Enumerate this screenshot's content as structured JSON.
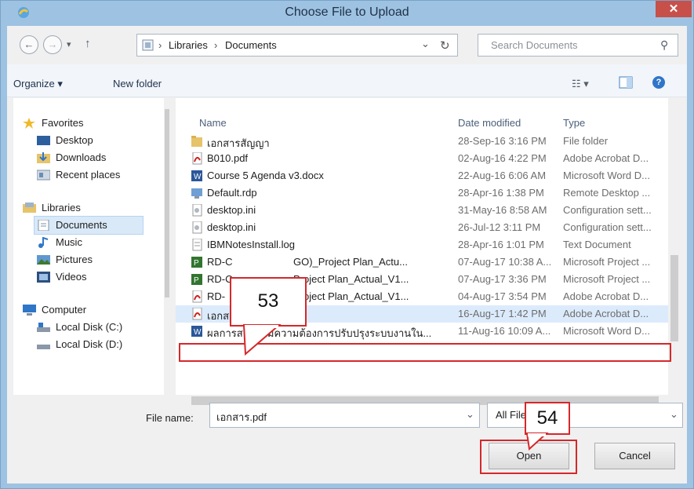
{
  "window": {
    "title": "Choose File to Upload",
    "close_glyph": "✕"
  },
  "nav_buttons": {
    "back": "←",
    "forward": "→",
    "recent": "▾",
    "up": "↑"
  },
  "address": {
    "crumbs": [
      "Libraries",
      "Documents"
    ],
    "sep": "›",
    "dropdown": "⌄",
    "refresh": "↻"
  },
  "search": {
    "placeholder": "Search Documents",
    "icon": "⚲"
  },
  "toolbar": {
    "organize": "Organize ▾",
    "new_folder": "New folder",
    "view": "☷ ▾",
    "help": "?"
  },
  "nav_pane": {
    "favorites": {
      "label": "Favorites",
      "items": [
        "Desktop",
        "Downloads",
        "Recent places"
      ]
    },
    "libraries": {
      "label": "Libraries",
      "items": [
        "Documents",
        "Music",
        "Pictures",
        "Videos"
      ]
    },
    "computer": {
      "label": "Computer",
      "items": [
        "Local Disk (C:)",
        "Local Disk (D:)"
      ]
    }
  },
  "columns": {
    "name": "Name",
    "date": "Date modified",
    "type": "Type"
  },
  "files": [
    {
      "name": "เอกสารสัญญา",
      "date": "28-Sep-16 3:16 PM",
      "type": "File folder",
      "icon": "folder-icon"
    },
    {
      "name": "B010.pdf",
      "date": "02-Aug-16 4:22 PM",
      "type": "Adobe Acrobat D...",
      "icon": "pdf-icon"
    },
    {
      "name": "Course 5 Agenda v3.docx",
      "date": "22-Aug-16 6:06 AM",
      "type": "Microsoft Word D...",
      "icon": "word-icon"
    },
    {
      "name": "Default.rdp",
      "date": "28-Apr-16 1:38 PM",
      "type": "Remote Desktop ...",
      "icon": "rdp-icon"
    },
    {
      "name": "desktop.ini",
      "date": "31-May-16 8:58 AM",
      "type": "Configuration sett...",
      "icon": "ini-icon"
    },
    {
      "name": "desktop.ini",
      "date": "26-Jul-12 3:11 PM",
      "type": "Configuration sett...",
      "icon": "ini-icon"
    },
    {
      "name": "IBMNotesInstall.log",
      "date": "28-Apr-16 1:01 PM",
      "type": "Text Document",
      "icon": "text-icon"
    },
    {
      "name": "RD-C",
      "name2": "GO)_Project Plan_Actu...",
      "date": "07-Aug-17 10:38 A...",
      "type": "Microsoft Project ...",
      "icon": "project-icon"
    },
    {
      "name": "RD-C",
      "name2": "Project Plan_Actual_V1...",
      "date": "07-Aug-17 3:36 PM",
      "type": "Microsoft Project ...",
      "icon": "project-icon"
    },
    {
      "name": "RD-",
      "name2": "Project Plan_Actual_V1...",
      "date": "04-Aug-17 3:54 PM",
      "type": "Adobe Acrobat D...",
      "icon": "pdf-icon"
    },
    {
      "name": "เอกสาร.pdf",
      "date": "16-Aug-17 1:42 PM",
      "type": "Adobe Acrobat D...",
      "icon": "pdf-icon"
    },
    {
      "name": "ผลการสอบถามความต้องการปรับปรุงระบบงานใน...",
      "date": "11-Aug-16 10:09 A...",
      "type": "Microsoft Word D...",
      "icon": "word-icon"
    }
  ],
  "bottom": {
    "file_name_label": "File name:",
    "file_name_value": "เอกสาร.pdf",
    "filter_value": "All File",
    "open_label": "Open",
    "cancel_label": "Cancel"
  },
  "annotations": {
    "callout_53": "53",
    "callout_54": "54"
  },
  "colors": {
    "highlight": "#d5282a",
    "titlebar": "#9ec2e2",
    "close": "#c7504b"
  }
}
